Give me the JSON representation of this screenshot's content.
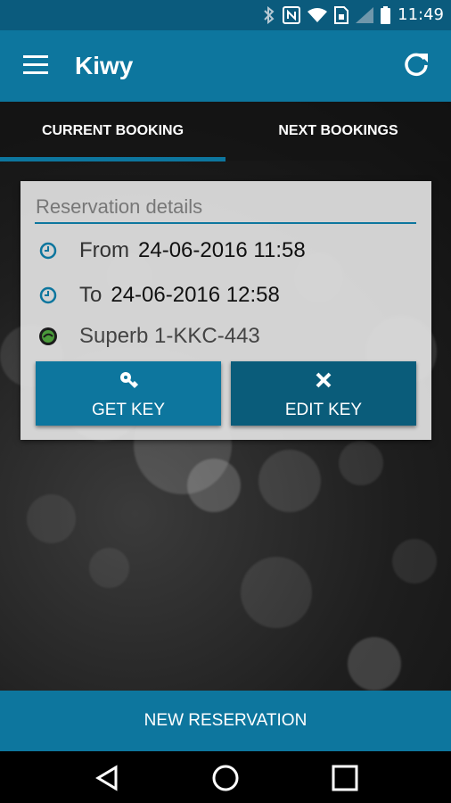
{
  "status_bar": {
    "time": "11:49",
    "icons": [
      "bluetooth-icon",
      "nfc-icon",
      "wifi-icon",
      "sim-icon",
      "signal-icon",
      "battery-icon"
    ]
  },
  "app_bar": {
    "title": "Kiwy",
    "left_icon": "menu-icon",
    "right_icon": "refresh-icon"
  },
  "tabs": [
    {
      "label": "CURRENT BOOKING",
      "selected": true
    },
    {
      "label": "NEXT BOOKINGS",
      "selected": false
    }
  ],
  "reservation": {
    "title": "Reservation details",
    "from_label": "From",
    "from_value": "24-06-2016 11:58",
    "to_label": "To",
    "to_value": "24-06-2016 12:58",
    "vehicle": "Superb 1-KKC-443",
    "get_key_label": "GET KEY",
    "edit_key_label": "EDIT KEY"
  },
  "bottom_action": {
    "label": "NEW RESERVATION"
  },
  "colors": {
    "primary": "#0d769e",
    "primary_dark": "#0b5b7d",
    "button_dark": "#0a5c7a"
  }
}
